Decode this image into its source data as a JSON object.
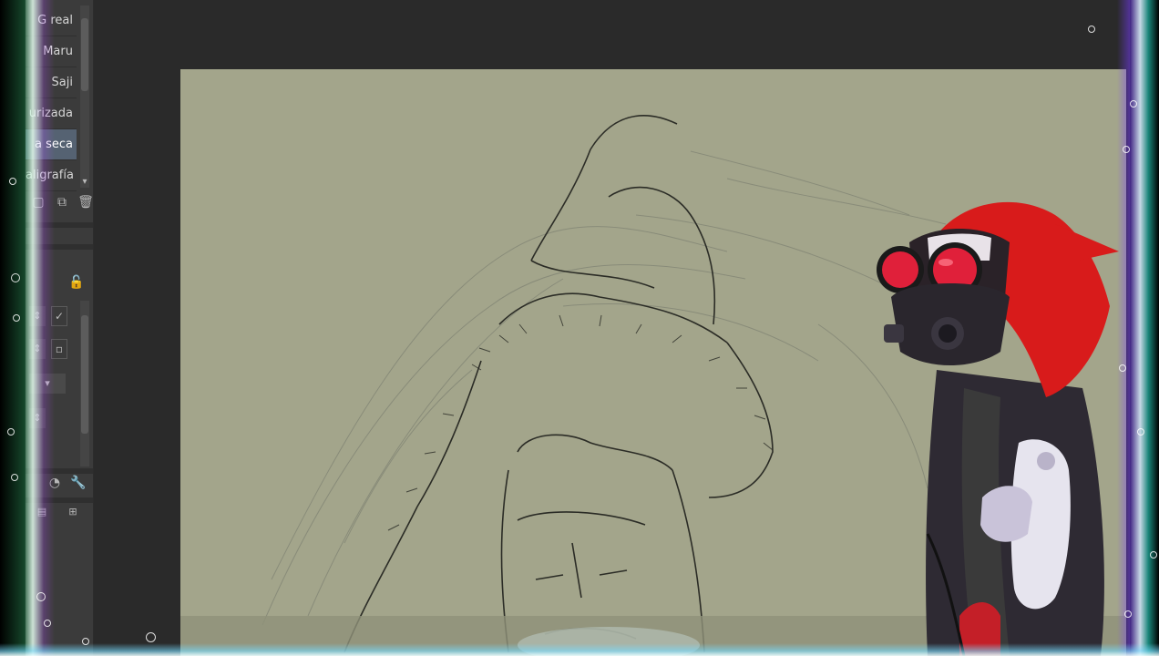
{
  "brushes": [
    {
      "label": "G real",
      "active": false
    },
    {
      "label": "Maru",
      "active": false
    },
    {
      "label": "Saji",
      "active": false
    },
    {
      "label": "urizada",
      "active": false
    },
    {
      "label": "a seca",
      "active": true
    },
    {
      "label": "aligrafía",
      "active": false
    }
  ],
  "colors": {
    "canvas": "#a3a58b",
    "panel": "#3b3b3b",
    "workspace": "#2a2a2a",
    "hood": "#d81b1b",
    "goggles": "#e0203a"
  },
  "icons": {
    "new_brush": "new-icon",
    "duplicate": "duplicate-icon",
    "delete": "trash-icon",
    "lock": "lock-icon",
    "settings": "wrench-icon",
    "timer": "dial-icon"
  }
}
